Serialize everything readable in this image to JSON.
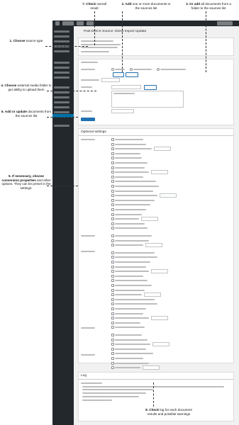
{
  "callouts": {
    "c1": {
      "bold": "1. Choose",
      "rest": " source type"
    },
    "c2": {
      "bold": "2. Add",
      "rest": " one or more documents to the sources list"
    },
    "c3": {
      "bold": "3. Or add",
      "rest": " all documents from a folder to the sources list"
    },
    "c4": {
      "bold": "4. Choose",
      "rest": " external media folder to get ability to upload them"
    },
    "c5": {
      "bold": "5. If necessary, choose conversion properties",
      "rest": " and other options. They can be preset in the settings."
    },
    "c6": {
      "bold": "6. Add or update",
      "rest": " documents from the sources list"
    },
    "c7": {
      "bold": "7. Check",
      "rest": " overall result"
    },
    "c8": {
      "bold": "8. Check",
      "rest": " log for each document results and possible warnings"
    }
  },
  "page": {
    "title": "Post DOCX Source: Direct Import Update"
  },
  "sections": {
    "options": "Optional settings",
    "log": "Log"
  }
}
